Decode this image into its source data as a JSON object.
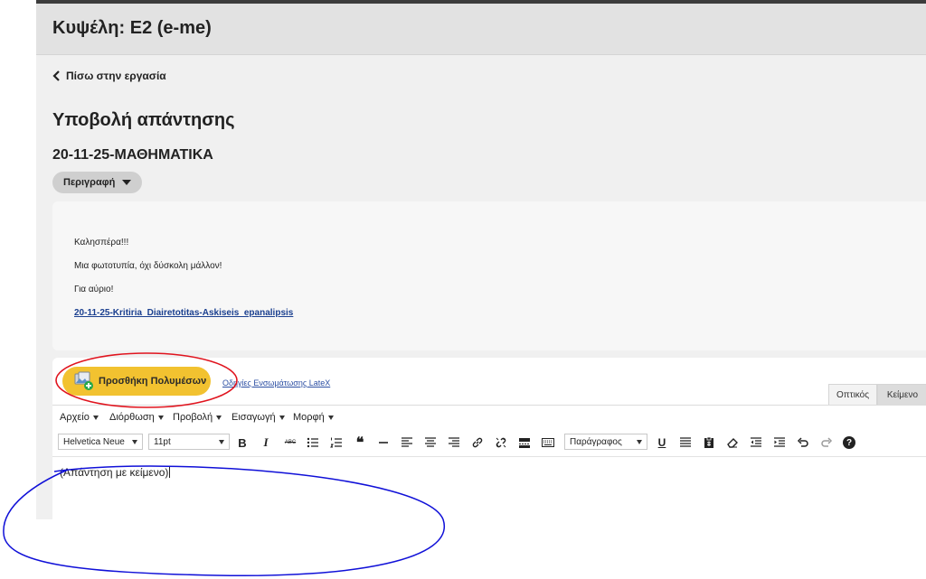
{
  "header": {
    "title": "Κυψέλη: Ε2 (e-me)"
  },
  "nav": {
    "back_label": "Πίσω στην εργασία"
  },
  "page": {
    "title": "Υποβολή απάντησης",
    "task_title": "20-11-25-ΜΑΘΗΜΑΤΙΚΑ"
  },
  "description": {
    "toggle_label": "Περιγραφή",
    "lines": [
      "Καλησπέρα!!!",
      "Μια φωτοτυπία, όχι δύσκολη μάλλον!",
      "Για αύριο!"
    ],
    "link": "20-11-25-Kritiria_Diairetotitas-Askiseis_epanalipsis"
  },
  "editor": {
    "add_media_label": "Προσθήκη Πολυμέσων",
    "latex_link": "Οδηγίες Ενσωμάτωσης LateX",
    "tabs": [
      {
        "label": "Οπτικός"
      },
      {
        "label": "Κείμενο"
      }
    ],
    "menu": [
      {
        "label": "Αρχείο"
      },
      {
        "label": "Διόρθωση"
      },
      {
        "label": "Προβολή"
      },
      {
        "label": "Εισαγωγή"
      },
      {
        "label": "Μορφή"
      }
    ],
    "toolbar": {
      "font_family": "Helvetica Neue",
      "font_size": "11pt",
      "block_format": "Παράγραφος",
      "strike_label": "ABC",
      "bold_label": "B",
      "italic_label": "I",
      "underline_label": "U",
      "quote_label": "❝",
      "help_label": "?"
    },
    "content": "(Απάντηση με κείμενο)"
  },
  "annotations": {
    "red_color": "#e0141e",
    "blue_color": "#1010d8"
  },
  "colors": {
    "media_button": "#f2c230",
    "link": "#1a3f8f",
    "header_bg": "#e2e2e2",
    "content_bg": "#f0f0f0"
  }
}
